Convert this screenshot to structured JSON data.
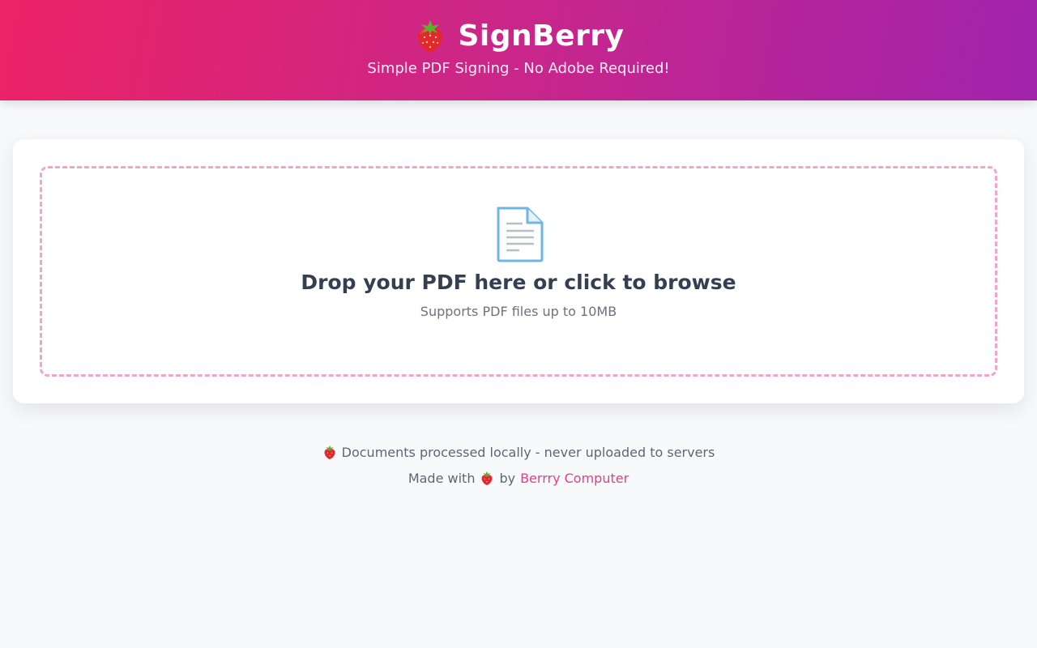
{
  "header": {
    "brand_icon": "strawberry-icon",
    "title": "SignBerry",
    "tagline": "Simple PDF Signing - No Adobe Required!",
    "gradient_start": "#ec2366",
    "gradient_end": "#a123ad"
  },
  "upload": {
    "icon": "document-icon",
    "title": "Drop your PDF here or click to browse",
    "subtitle": "Supports PDF files up to 10MB",
    "border_color": "#f4a3c9"
  },
  "footer": {
    "privacy_icon": "strawberry-icon",
    "privacy_text": "Documents processed locally - never uploaded to servers",
    "made_with_prefix": "Made with",
    "made_with_icon": "strawberry-icon",
    "made_with_by": "by",
    "author_link": "Berrry Computer",
    "link_color": "#e53d8a"
  }
}
